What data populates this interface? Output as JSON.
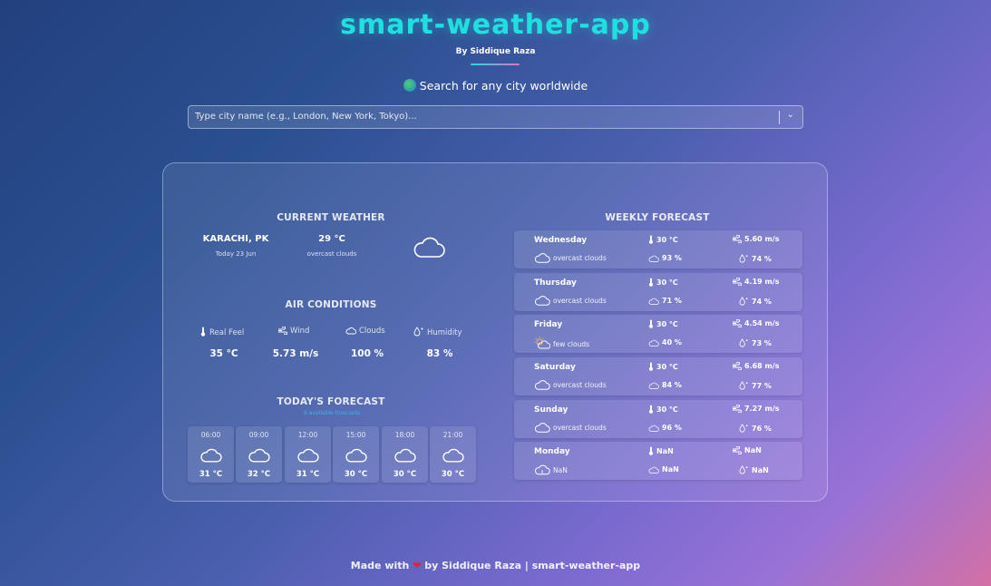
{
  "app": {
    "title": "smart-weather-app",
    "author": "By Siddique Raza",
    "search_hint": "Search for any city worldwide",
    "search_placeholder": "Type city name (e.g., London, New York, Tokyo)..."
  },
  "current_weather": {
    "heading": "CURRENT WEATHER",
    "city": "KARACHI, PK",
    "date": "Today 23 Jun",
    "temp": "29 °C",
    "description": "overcast clouds",
    "icon": "cloud-icon"
  },
  "air_conditions": {
    "heading": "AIR CONDITIONS",
    "items": [
      {
        "label": "Real Feel",
        "value": "35 °C",
        "icon": "thermometer-icon"
      },
      {
        "label": "Wind",
        "value": "5.73 m/s",
        "icon": "wind-icon"
      },
      {
        "label": "Clouds",
        "value": "100 %",
        "icon": "cloud-icon"
      },
      {
        "label": "Humidity",
        "value": "83 %",
        "icon": "humidity-icon"
      }
    ]
  },
  "todays_forecast": {
    "heading": "TODAY'S FORECAST",
    "subtitle": "6 available forecasts",
    "hours": [
      {
        "time": "06:00",
        "temp": "31 °C",
        "icon": "cloud-icon"
      },
      {
        "time": "09:00",
        "temp": "32 °C",
        "icon": "cloud-icon"
      },
      {
        "time": "12:00",
        "temp": "31 °C",
        "icon": "cloud-icon"
      },
      {
        "time": "15:00",
        "temp": "30 °C",
        "icon": "cloud-icon"
      },
      {
        "time": "18:00",
        "temp": "30 °C",
        "icon": "cloud-icon"
      },
      {
        "time": "21:00",
        "temp": "30 °C",
        "icon": "cloud-icon"
      }
    ]
  },
  "weekly_forecast": {
    "heading": "WEEKLY FORECAST",
    "days": [
      {
        "day": "Wednesday",
        "desc": "overcast clouds",
        "temp": "30 °C",
        "wind": "5.60 m/s",
        "clouds": "93 %",
        "humidity": "74 %",
        "icon": "cloud-icon"
      },
      {
        "day": "Thursday",
        "desc": "overcast clouds",
        "temp": "30 °C",
        "wind": "4.19 m/s",
        "clouds": "71 %",
        "humidity": "74 %",
        "icon": "cloud-icon"
      },
      {
        "day": "Friday",
        "desc": "few clouds",
        "temp": "30 °C",
        "wind": "4.54 m/s",
        "clouds": "40 %",
        "humidity": "73 %",
        "icon": "sun-cloud-icon"
      },
      {
        "day": "Saturday",
        "desc": "overcast clouds",
        "temp": "30 °C",
        "wind": "6.68 m/s",
        "clouds": "84 %",
        "humidity": "77 %",
        "icon": "cloud-icon"
      },
      {
        "day": "Sunday",
        "desc": "overcast clouds",
        "temp": "30 °C",
        "wind": "7.27 m/s",
        "clouds": "96 %",
        "humidity": "76 %",
        "icon": "cloud-icon"
      },
      {
        "day": "Monday",
        "desc": "NaN",
        "temp": "NaN",
        "wind": "NaN",
        "clouds": "NaN",
        "humidity": "NaN",
        "icon": "unknown-weather-icon"
      }
    ]
  },
  "footer": {
    "prefix": "Made with",
    "suffix": "by Siddique Raza | smart-weather-app"
  },
  "colors": {
    "title": "#1fe0e0",
    "accent_blue": "#35b7e6",
    "heart": "#e0223b"
  }
}
